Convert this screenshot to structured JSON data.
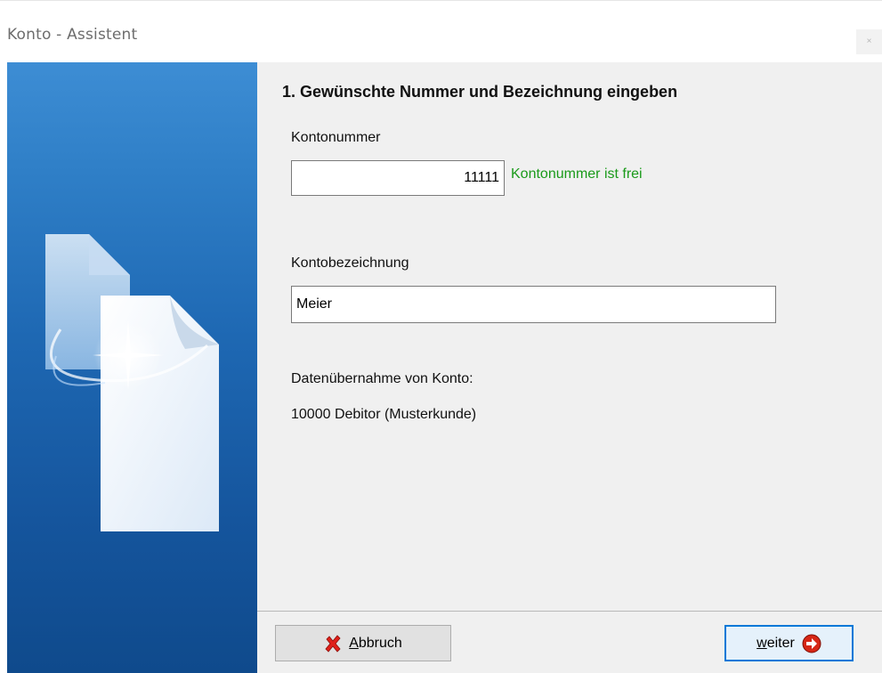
{
  "window": {
    "title": "Konto - Assistent",
    "close_glyph": "×"
  },
  "step": {
    "heading": "1. Gewünschte Nummer und Bezeichnung eingeben"
  },
  "account_number": {
    "label": "Kontonummer",
    "value": "11111",
    "status": "Kontonummer ist frei",
    "status_color": "#1a9a1a"
  },
  "account_name": {
    "label": "Kontobezeichnung",
    "value": "Meier"
  },
  "data_transfer": {
    "label": "Datenübernahme von Konto:",
    "source": "10000 Debitor (Musterkunde)"
  },
  "buttons": {
    "cancel": {
      "mnemonic": "A",
      "rest": "bbruch",
      "icon": "red-x-icon"
    },
    "next": {
      "mnemonic": "w",
      "rest": "eiter",
      "icon": "arrow-right-circle-icon"
    }
  },
  "colors": {
    "sidebar_top": "#3d8dd4",
    "sidebar_bottom": "#0f4a8c",
    "cancel_icon": "#e0201a",
    "next_icon": "#d62716",
    "focus_border": "#0078d7"
  }
}
